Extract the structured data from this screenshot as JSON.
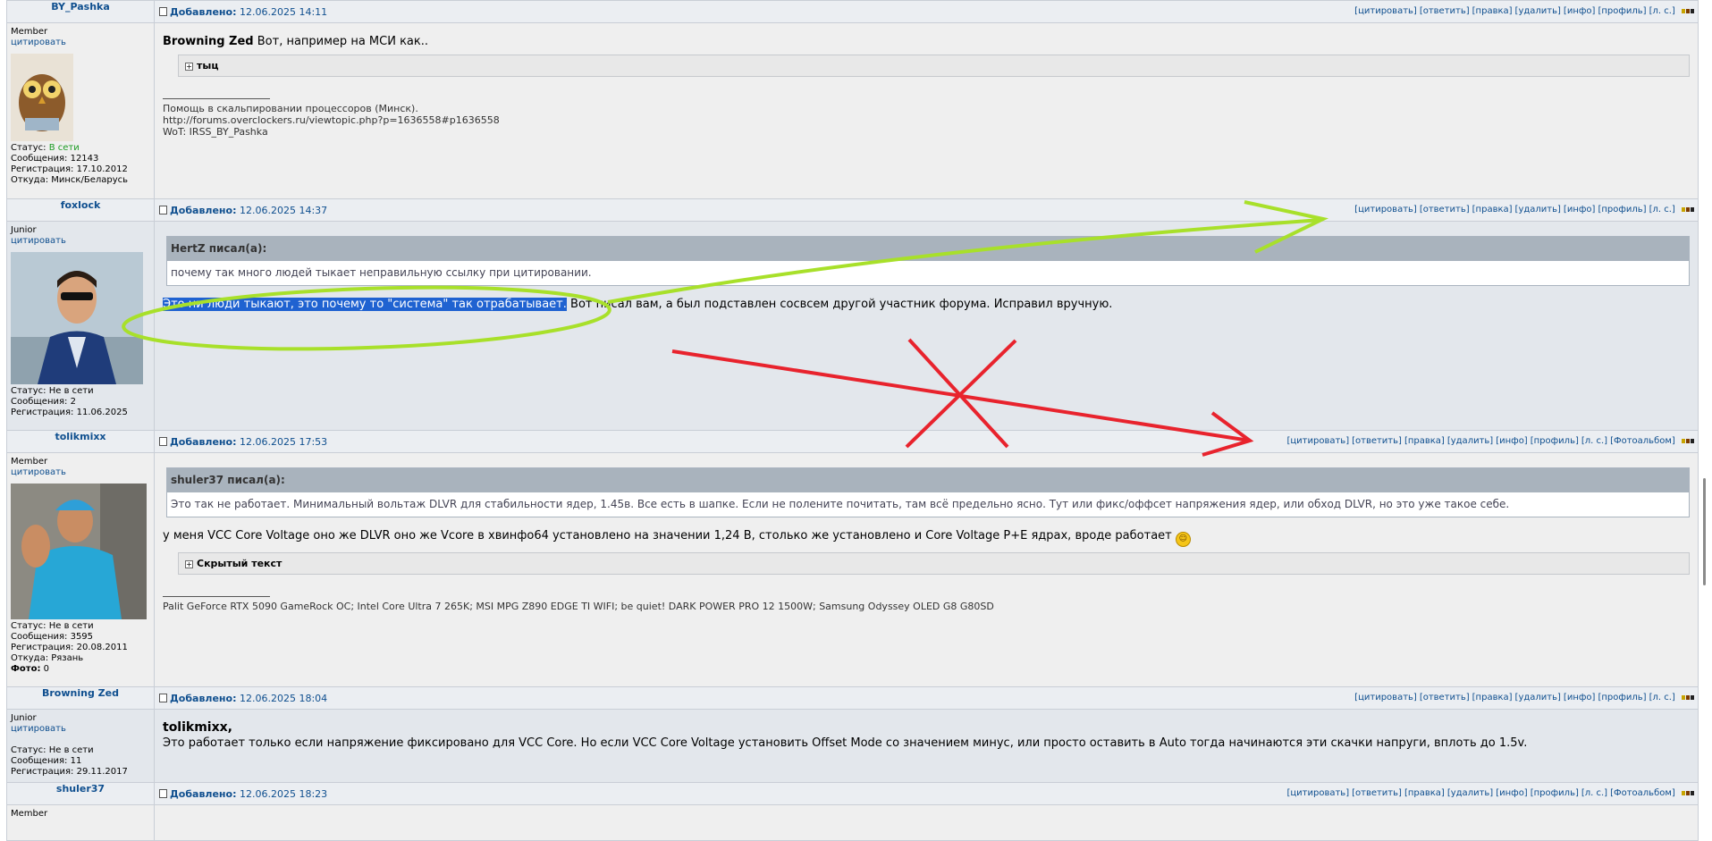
{
  "actions_common": {
    "cite": "[цитировать]",
    "reply": "[ответить]",
    "edit": "[правка]",
    "delete": "[удалить]",
    "info": "[инфо]",
    "profile": "[профиль]",
    "pm": "[л. с.]",
    "album": "[Фотоальбом]"
  },
  "posted_label": "Добавлено:",
  "cite_label": "цитировать",
  "status_label": "Статус:",
  "posts_label": "Сообщения:",
  "reg_label": "Регистрация:",
  "from_label": "Откуда:",
  "photo_label": "Фото:",
  "posts": [
    {
      "author": "BY_Pashka",
      "date": "12.06.2025 14:11",
      "rank": "Member",
      "status": "В сети",
      "messages": "12143",
      "registered": "17.10.2012",
      "from": "Минск/Беларусь",
      "lead": "Browning Zed",
      "text": "Вот, например на МСИ как..",
      "spoiler": "тыц",
      "sig": [
        "Помощь в скальпировании процессоров (Минск).",
        "http://forums.overclockers.ru/viewtopic.php?p=1636558#p1636558",
        "WoT: IRSS_BY_Pashka"
      ]
    },
    {
      "author": "foxlock",
      "date": "12.06.2025 14:37",
      "rank": "Junior",
      "status": "Не в сети",
      "messages": "2",
      "registered": "11.06.2025",
      "quote_head": "HertZ писал(а):",
      "quote_body": "почему так много людей тыкает неправильную ссылку при цитировании.",
      "selected": "Это ни люди тыкают, это почему то \"система\" так отрабатывает.",
      "text": " Вот писал вам, а был подставлен сосвсем другой участник форума. Исправил вручную."
    },
    {
      "author": "tolikmixx",
      "date": "12.06.2025 17:53",
      "rank": "Member",
      "status": "Не в сети",
      "messages": "3595",
      "registered": "20.08.2011",
      "from": "Рязань",
      "photo": "0",
      "quote_head": "shuler37 писал(а):",
      "quote_body": "Это так не работает. Минимальный вольтаж DLVR для стабильности ядер, 1.45в. Все есть в шапке. Если не полените почитать, там всё предельно ясно. Тут или фикс/оффсет напряжения ядер, или обход DLVR, но это уже такое себе.",
      "text": "у меня VCC Core Voltage оно же DLVR оно же Vcore в хвинфо64 установлено на значении 1,24 В, столько же установлено и Core Voltage P+E ядрах, вроде работает",
      "spoiler": "Скрытый текст",
      "sig": [
        "Palit GeForce RTX 5090 GameRock OC; Intel Core Ultra 7 265K; MSI MPG Z890 EDGE TI WIFI; be quiet! DARK POWER PRO 12 1500W; Samsung Odyssey OLED G8 G80SD"
      ]
    },
    {
      "author": "Browning Zed",
      "date": "12.06.2025 18:04",
      "rank": "Junior",
      "status": "Не в сети",
      "messages": "11",
      "registered": "29.11.2017",
      "lead": "tolikmixx,",
      "text": "Это работает только если напряжение фиксировано для VCC Core. Но если VCC Core Voltage установить Offset Mode со значением минус, или просто оставить в Auto тогда начинаются эти скачки напруги, вплоть до 1.5v."
    },
    {
      "author": "shuler37",
      "date": "12.06.2025 18:23",
      "rank": "Member"
    }
  ],
  "colors": {
    "link": "#0f4f8f",
    "selection": "#1f62d1",
    "annotation_green": "#a8e02a",
    "annotation_red": "#e8232d"
  }
}
